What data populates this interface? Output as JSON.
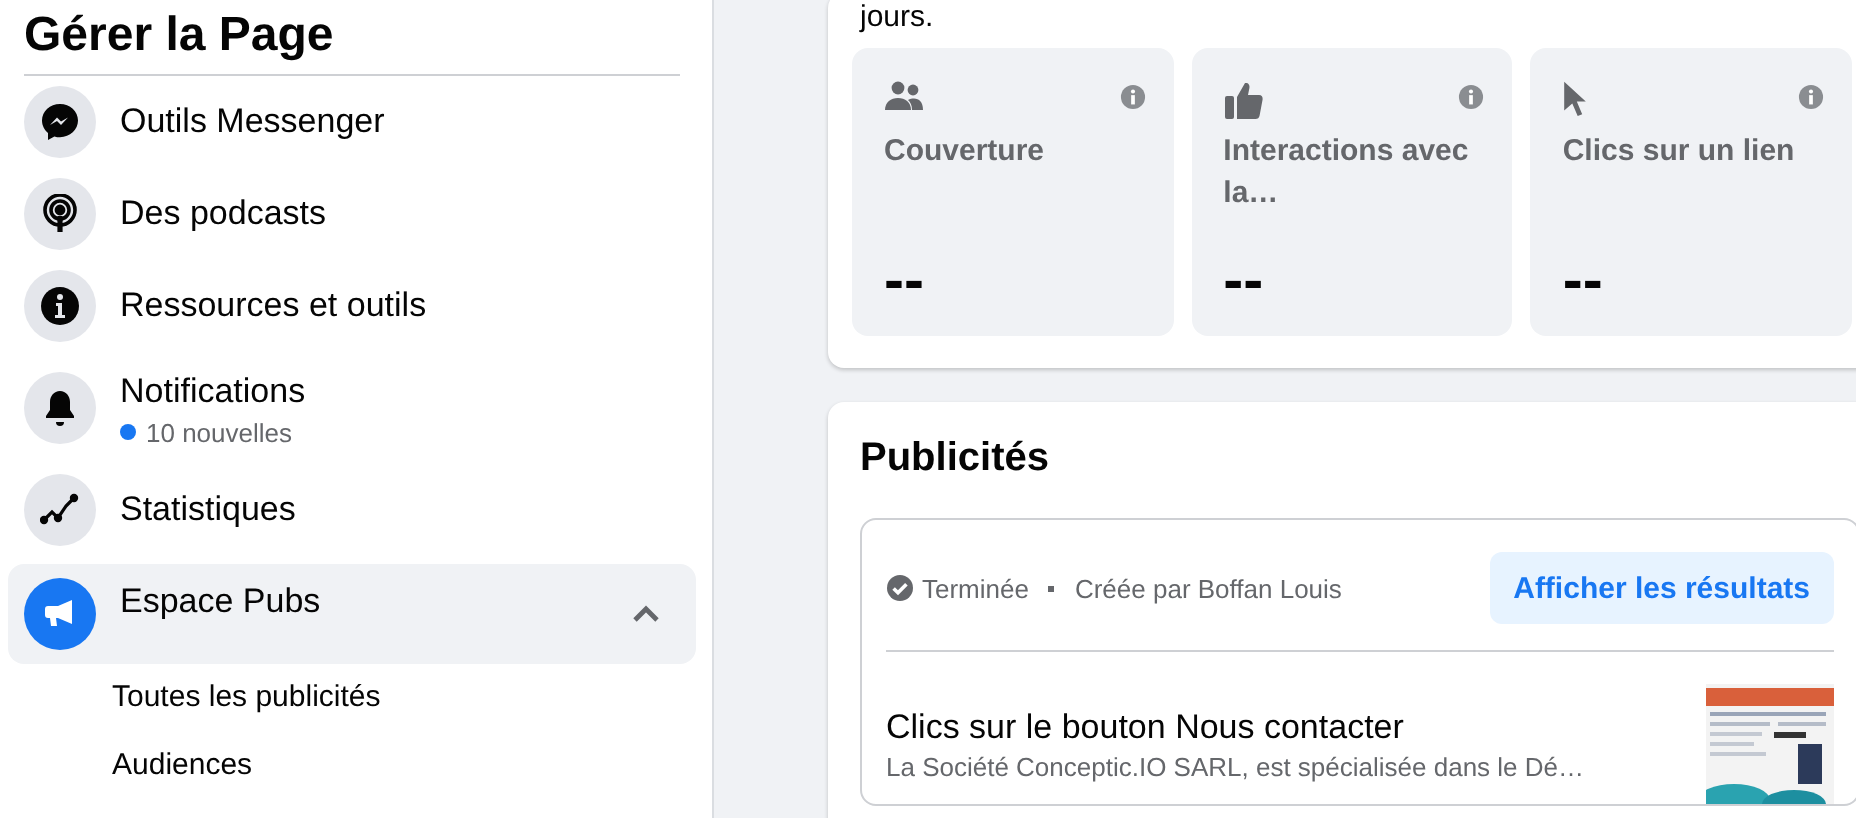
{
  "sidebar": {
    "title": "Gérer la Page",
    "items": [
      {
        "label": "Outils Messenger",
        "selected": false
      },
      {
        "label": "Des podcasts",
        "selected": false
      },
      {
        "label": "Ressources et outils",
        "selected": false
      },
      {
        "label": "Notifications",
        "selected": false,
        "subtitle": "10 nouvelles",
        "color": "#1877f2"
      },
      {
        "label": "Statistiques",
        "selected": false
      },
      {
        "label": "Espace Pubs",
        "selected": true,
        "expanded": true
      }
    ],
    "subitems": [
      "Toutes les publicités",
      "Audiences"
    ]
  },
  "insights": {
    "intro_tail": "jours.",
    "metrics": [
      {
        "label": "Couverture",
        "value": "--"
      },
      {
        "label": "Interactions avec la…",
        "value": "--"
      },
      {
        "label": "Clics sur un lien",
        "value": "--"
      }
    ]
  },
  "ads": {
    "title": "Publicités",
    "status": "Terminée",
    "creator": "Créée par Boffan Louis",
    "button": "Afficher les résultats",
    "ad_title": "Clics sur le bouton Nous contacter",
    "ad_description": "La Société Conceptic.IO SARL, est spécialisée dans le Dé…"
  }
}
